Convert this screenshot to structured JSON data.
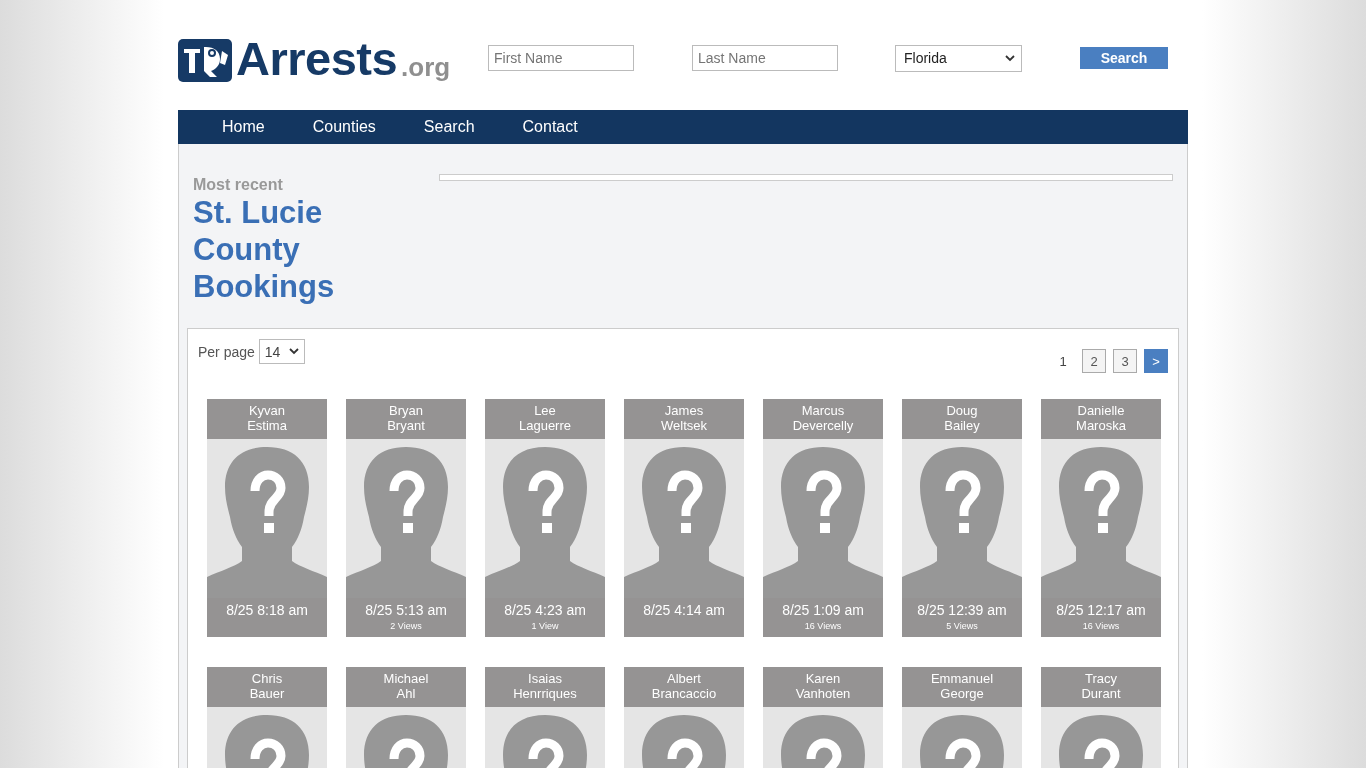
{
  "logo": {
    "name": "Arrests",
    "suffix": ".org"
  },
  "search_form": {
    "first_name": {
      "placeholder": "First Name"
    },
    "last_name": {
      "placeholder": "Last Name"
    },
    "state": {
      "value": "Florida"
    },
    "button": "Search"
  },
  "nav": [
    {
      "label": "Home"
    },
    {
      "label": "Counties"
    },
    {
      "label": "Search"
    },
    {
      "label": "Contact"
    }
  ],
  "heading": {
    "kicker": "Most recent",
    "title": "St. Lucie County Bookings"
  },
  "per_page": {
    "label": "Per page",
    "value": "14"
  },
  "pagination": [
    {
      "label": "1",
      "selected": true
    },
    {
      "label": "2",
      "selected": false
    },
    {
      "label": "3",
      "selected": false
    },
    {
      "label": ">",
      "selected": false,
      "kind": "next"
    }
  ],
  "bookings": [
    {
      "first": "Kyvan",
      "last": "Estima",
      "time": "8/25 8:18 am"
    },
    {
      "first": "Bryan",
      "last": "Bryant",
      "time": "8/25 5:13 am",
      "views": "2 Views"
    },
    {
      "first": "Lee",
      "last": "Laguerre",
      "time": "8/25 4:23 am",
      "views": "1 View"
    },
    {
      "first": "James",
      "last": "Weltsek",
      "time": "8/25 4:14 am"
    },
    {
      "first": "Marcus",
      "last": "Devercelly",
      "time": "8/25 1:09 am",
      "views": "16 Views"
    },
    {
      "first": "Doug",
      "last": "Bailey",
      "time": "8/25 12:39 am",
      "views": "5 Views"
    },
    {
      "first": "Danielle",
      "last": "Maroska",
      "time": "8/25 12:17 am",
      "views": "16 Views"
    },
    {
      "first": "Chris",
      "last": "Bauer"
    },
    {
      "first": "Michael",
      "last": "Ahl"
    },
    {
      "first": "Isaias",
      "last": "Henrriques"
    },
    {
      "first": "Albert",
      "last": "Brancaccio"
    },
    {
      "first": "Karen",
      "last": "Vanhoten"
    },
    {
      "first": "Emmanuel",
      "last": "George"
    },
    {
      "first": "Tracy",
      "last": "Durant"
    }
  ]
}
